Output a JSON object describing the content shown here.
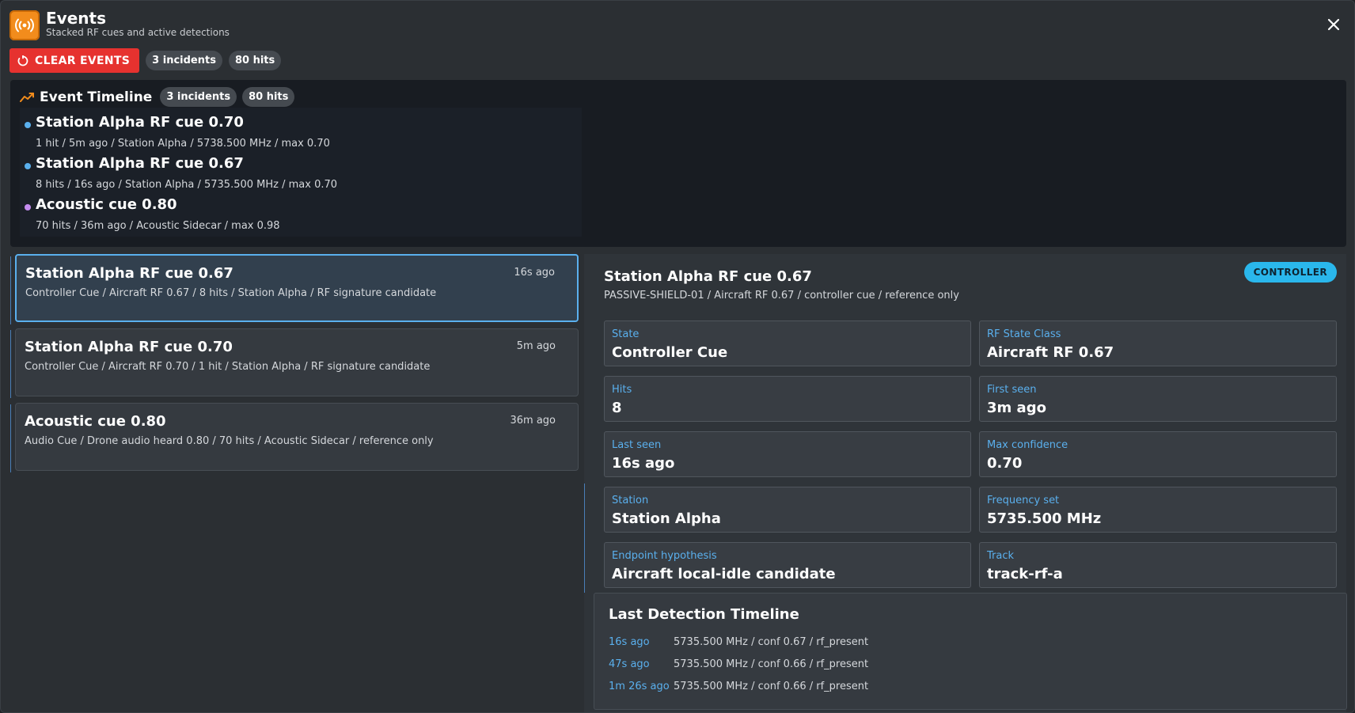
{
  "header": {
    "title": "Events",
    "subtitle": "Stacked RF cues and active detections",
    "clear_label": "CLEAR EVENTS",
    "incidents_label": "3 incidents",
    "hits_label": "80 hits"
  },
  "timeline": {
    "title": "Event Timeline",
    "incidents_label": "3 incidents",
    "hits_label": "80 hits",
    "items": [
      {
        "title": "Station Alpha RF cue 0.70",
        "meta": "1 hit / 5m ago / Station Alpha / 5738.500 MHz / max 0.70",
        "color": "#5ab0ee"
      },
      {
        "title": "Station Alpha RF cue 0.67",
        "meta": "8 hits / 16s ago / Station Alpha / 5735.500 MHz / max 0.70",
        "color": "#5ab0ee"
      },
      {
        "title": "Acoustic cue 0.80",
        "meta": "70 hits / 36m ago / Acoustic Sidecar / max 0.98",
        "color": "#c58cf0"
      }
    ]
  },
  "events": [
    {
      "title": "Station Alpha RF cue 0.67",
      "meta": "Controller Cue / Aircraft RF 0.67 / 8 hits / Station Alpha / RF signature candidate",
      "age": "16s ago",
      "selected": true
    },
    {
      "title": "Station Alpha RF cue 0.70",
      "meta": "Controller Cue / Aircraft RF 0.70 / 1 hit / Station Alpha / RF signature candidate",
      "age": "5m ago",
      "selected": false
    },
    {
      "title": "Acoustic cue 0.80",
      "meta": "Audio Cue / Drone audio heard 0.80 / 70 hits / Acoustic Sidecar / reference only",
      "age": "36m ago",
      "selected": false
    }
  ],
  "detail": {
    "title": "Station Alpha RF cue 0.67",
    "subtitle": "PASSIVE-SHIELD-01 / Aircraft RF 0.67 / controller cue / reference only",
    "badge": "CONTROLLER",
    "fields": [
      {
        "label": "State",
        "value": "Controller Cue"
      },
      {
        "label": "RF State Class",
        "value": "Aircraft RF 0.67"
      },
      {
        "label": "Hits",
        "value": "8"
      },
      {
        "label": "First seen",
        "value": "3m ago"
      },
      {
        "label": "Last seen",
        "value": "16s ago"
      },
      {
        "label": "Max confidence",
        "value": "0.70"
      },
      {
        "label": "Station",
        "value": "Station Alpha"
      },
      {
        "label": "Frequency set",
        "value": "5735.500 MHz"
      },
      {
        "label": "Endpoint hypothesis",
        "value": "Aircraft local-idle candidate"
      },
      {
        "label": "Track",
        "value": "track-rf-a"
      }
    ],
    "last_detection": {
      "title": "Last Detection Timeline",
      "rows": [
        {
          "age": "16s ago",
          "text": "5735.500 MHz / conf 0.67 / rf_present"
        },
        {
          "age": "47s ago",
          "text": "5735.500 MHz / conf 0.66 / rf_present"
        },
        {
          "age": "1m 26s ago",
          "text": "5735.500 MHz / conf 0.66 / rf_present"
        }
      ]
    }
  }
}
